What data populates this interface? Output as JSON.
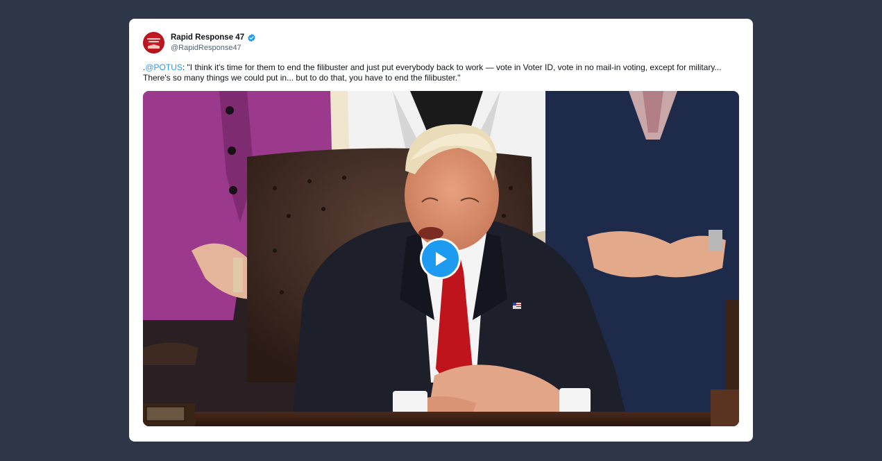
{
  "tweet": {
    "account_name": "Rapid Response 47",
    "handle": "@RapidResponse47",
    "verified": true,
    "text_prefix": ".",
    "mention": "@POTUS",
    "text_body": ": \"I think it's time for them to end the filibuster and just put everybody back to work — vote in Voter ID, vote in no mail-in voting, except for military... There's so many things we could put in... but to do that, you have to end the filibuster.\""
  },
  "media": {
    "type": "video",
    "play_icon": "play-icon"
  },
  "colors": {
    "page_background": "#2d3748",
    "card_background": "#ffffff",
    "link": "#1d9bf0",
    "verified_badge": "#1d9bf0",
    "play_button": "#1d9bf0",
    "avatar": "#b5121b"
  },
  "icons": {
    "verified": "verified-badge-icon",
    "play": "play-icon",
    "avatar": "avatar-logo"
  }
}
